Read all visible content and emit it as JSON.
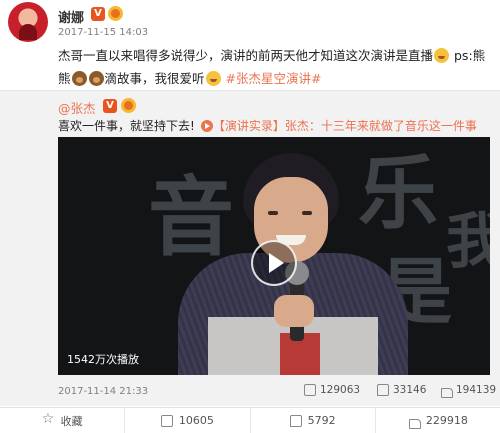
{
  "post": {
    "author": "谢娜",
    "time": "2017-11-15 14:03",
    "text_line1": "杰哥一直以来唱得多说得少，演讲的前两天他才知道这次演讲是直播",
    "text_ps": "ps:熊",
    "text_line2a": "熊",
    "text_line2b": "滴故事，我很爱听",
    "hashtag": "#张杰星空演讲#"
  },
  "repost": {
    "author": "@张杰",
    "text": "喜欢一件事，就坚持下去!",
    "link_tag": "【演讲实录】",
    "link_text": "张杰：十三年来就做了音乐这一件事",
    "video": {
      "view_count": "1542万次播放",
      "bg_chars": [
        "音",
        "乐",
        "是",
        "我"
      ]
    },
    "time": "2017-11-14 21:33",
    "shares": "129063",
    "comments": "33146",
    "likes": "194139"
  },
  "actions": {
    "favorite_label": "收藏",
    "share_count": "10605",
    "comment_count": "5792",
    "like_count": "229918"
  },
  "colors": {
    "link": "#eb7350",
    "verified_badge": "#e8541e",
    "repost_bg": "#f2f2f2"
  },
  "icons": [
    "avatar",
    "verified-badge",
    "fan-badge",
    "laugh-emoji",
    "peace-hand-emoji",
    "bear-emoji",
    "play-icon",
    "share-icon",
    "comment-icon",
    "like-icon",
    "star-icon"
  ]
}
